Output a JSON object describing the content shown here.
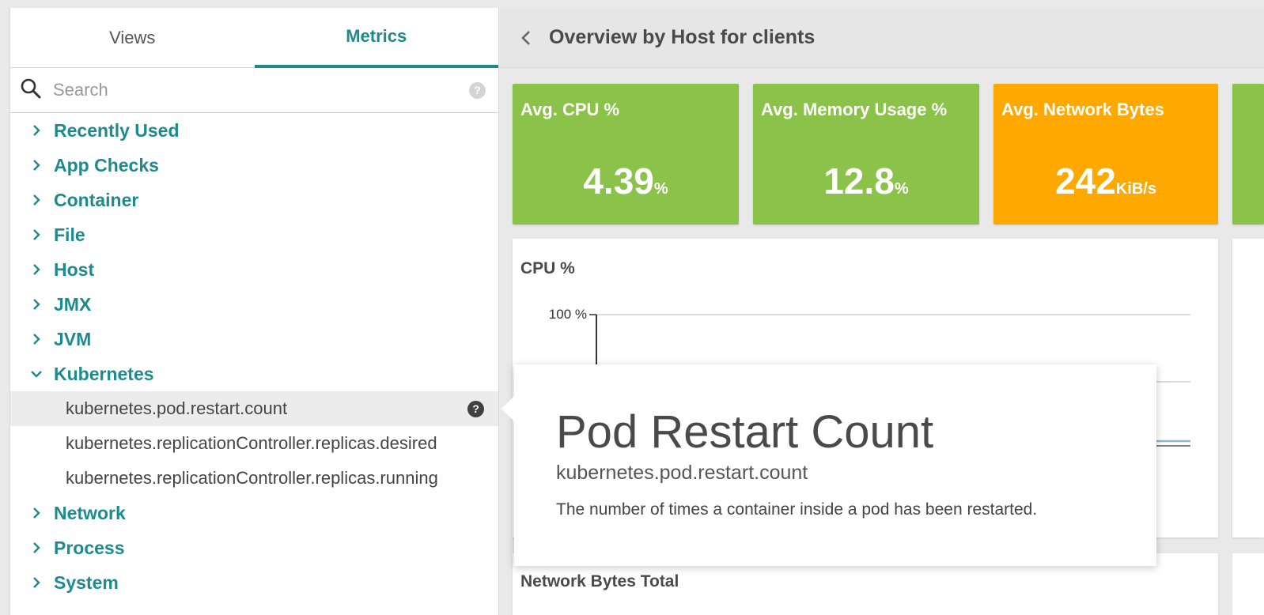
{
  "tabs": [
    {
      "label": "Views"
    },
    {
      "label": "Metrics"
    }
  ],
  "search": {
    "placeholder": "Search"
  },
  "tree": {
    "categories_top": [
      {
        "label": "Recently Used"
      },
      {
        "label": "App Checks"
      },
      {
        "label": "Container"
      },
      {
        "label": "File"
      },
      {
        "label": "Host"
      },
      {
        "label": "JMX"
      },
      {
        "label": "JVM"
      }
    ],
    "expanded": {
      "label": "Kubernetes",
      "metrics": [
        {
          "label": "kubernetes.pod.restart.count",
          "selected": true
        },
        {
          "label": "kubernetes.replicationController.replicas.desired"
        },
        {
          "label": "kubernetes.replicationController.replicas.running"
        }
      ]
    },
    "categories_bottom": [
      {
        "label": "Network"
      },
      {
        "label": "Process"
      },
      {
        "label": "System"
      }
    ]
  },
  "header": {
    "title": "Overview by Host for clients"
  },
  "tiles": [
    {
      "title": "Avg. CPU %",
      "value": "4.39",
      "unit": "%",
      "color": "#8bc34a"
    },
    {
      "title": "Avg. Memory Usage %",
      "value": "12.8",
      "unit": "%",
      "color": "#8bc34a"
    },
    {
      "title": "Avg. Network Bytes",
      "value": "242",
      "unit": "KiB/s",
      "color": "#ffa800"
    }
  ],
  "chart": {
    "title": "CPU %",
    "y_tick": "100 %"
  },
  "card2": {
    "title": "Network Bytes Total"
  },
  "popover": {
    "title": "Pod Restart Count",
    "metric_id": "kubernetes.pod.restart.count",
    "description": "The number of times a container inside a pod has been restarted."
  },
  "icons": {
    "search": "search-icon",
    "chevron_right": "chevron-right-icon",
    "chevron_down": "chevron-down-icon",
    "help": "help-icon",
    "back": "chevron-left-icon"
  }
}
